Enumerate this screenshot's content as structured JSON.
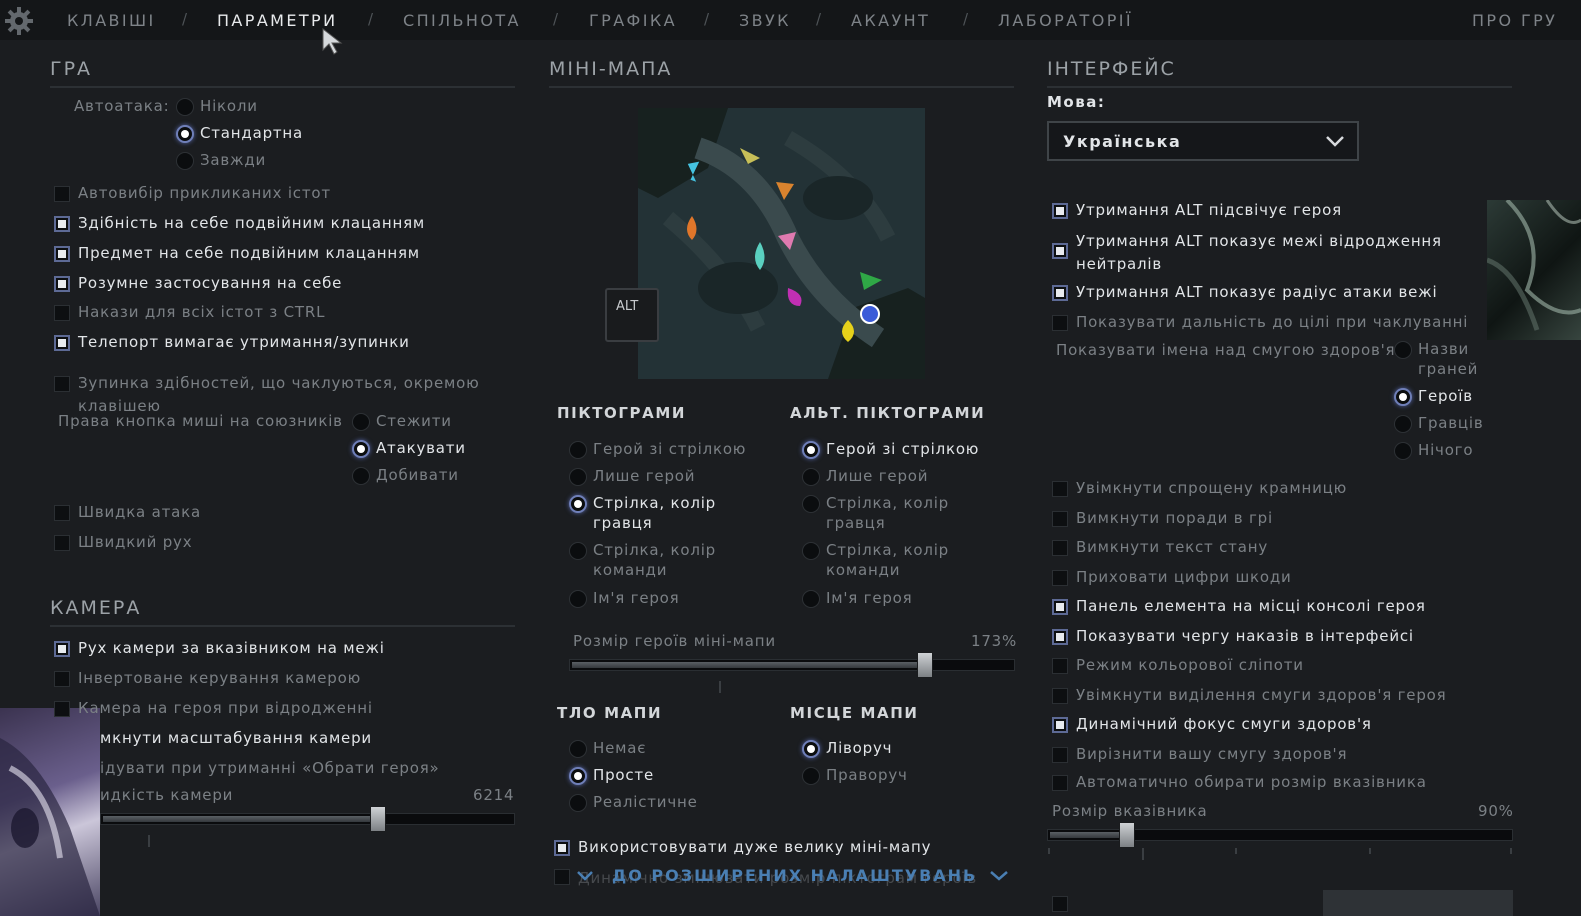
{
  "nav": {
    "items": [
      "КЛАВІШІ",
      "ПАРАМЕТРИ",
      "СПІЛЬНОТА",
      "ГРАФІКА",
      "ЗВУК",
      "АКАУНТ",
      "ЛАБОРАТОРІЇ"
    ],
    "sep": "/",
    "about": "ПРО ГРУ",
    "active": "ПАРАМЕТРИ"
  },
  "game": {
    "title": "ГРА",
    "autoattack_label": "Автоатака:",
    "autoattack_options": [
      "Ніколи",
      "Стандартна",
      "Завжди"
    ],
    "autoattack_selected": "Стандартна",
    "checks": [
      {
        "label": "Автовибір прикликаних істот",
        "checked": false
      },
      {
        "label": "Здібність на себе подвійним клацанням",
        "checked": true
      },
      {
        "label": "Предмет на себе подвійним клацанням",
        "checked": true
      },
      {
        "label": "Розумне застосування на себе",
        "checked": true
      },
      {
        "label": "Накази для всіх істот з CTRL",
        "checked": false
      },
      {
        "label": "Телепорт вимагає утримання/зупинки",
        "checked": true
      },
      {
        "label1": "Зупинка здібностей, що чаклуються, окремою",
        "label2": "клавішею",
        "checked": false
      }
    ],
    "rmb_label": "Права кнопка миші на союзників",
    "rmb_options": [
      "Стежити",
      "Атакувати",
      "Добивати"
    ],
    "rmb_selected": "Атакувати",
    "quick": [
      {
        "label": "Швидка атака",
        "checked": false
      },
      {
        "label": "Швидкий рух",
        "checked": false
      }
    ]
  },
  "camera": {
    "title": "КАМЕРА",
    "checks": [
      {
        "label": "Рух камери за вказівником на межі",
        "checked": true
      },
      {
        "label": "Інвертоване керування камерою",
        "checked": false
      },
      {
        "label": "Камера на героя при відродженні",
        "checked": false
      }
    ],
    "extra1": "мкнути масштабування камери",
    "extra2": "ідувати при утриманні «Обрати героя»",
    "speed_label": "идкість камери",
    "speed_value": "6214",
    "speed_fraction": 0.67
  },
  "minimap": {
    "title": "МІНІ-МАПА",
    "alt_key": "ALT",
    "icons_title": "ПІКТОГРАМИ",
    "alt_icons_title": "АЛЬТ. ПІКТОГРАМИ",
    "icon_options": [
      {
        "l1": "Герой зі стрілкою",
        "l2": ""
      },
      {
        "l1": "Лише герой",
        "l2": ""
      },
      {
        "l1": "Стрілка, колір",
        "l2": "гравця"
      },
      {
        "l1": "Стрілка, колір",
        "l2": "команди"
      },
      {
        "l1": "Ім'я героя",
        "l2": ""
      }
    ],
    "icons_selected": 2,
    "alt_icons_selected": 0,
    "hero_size_label": "Розмір героїв міні-мапи",
    "hero_size_value": "173%",
    "hero_size_fraction": 0.8,
    "bg_title": "ТЛО МАПИ",
    "bg_options": [
      "Немає",
      "Просте",
      "Реалістичне"
    ],
    "bg_selected": "Просте",
    "place_title": "МІСЦЕ МАПИ",
    "place_options": [
      "Ліворуч",
      "Праворуч"
    ],
    "place_selected": "Ліворуч",
    "large_map": {
      "label": "Використовувати дуже велику міні-мапу",
      "checked": true
    },
    "dynamic_label": "Динамічно змінювати розмір піктограм героїв",
    "advanced_link": "ДО РОЗШИРЕНИХ НАЛАШТУВАНЬ"
  },
  "interface": {
    "title": "ІНТЕРФЕЙС",
    "lang_label": "Мова:",
    "lang_value": "Українська",
    "checks_top": [
      {
        "l1": "Утримання ALT підсвічує героя",
        "l2": "",
        "checked": true
      },
      {
        "l1": "Утримання ALT показує межі відродження",
        "l2": "нейтралів",
        "checked": true
      },
      {
        "l1": "Утримання ALT показує радіус атаки вежі",
        "l2": "",
        "checked": true
      },
      {
        "l1": "Показувати дальність до цілі при чаклуванні",
        "l2": "",
        "checked": false
      }
    ],
    "names_label": "Показувати імена над смугою здоров'я",
    "names_options": [
      {
        "l1": "Назви",
        "l2": "граней"
      },
      {
        "l1": "Героїв",
        "l2": ""
      },
      {
        "l1": "Гравців",
        "l2": ""
      },
      {
        "l1": "Нічого",
        "l2": ""
      }
    ],
    "names_selected": 1,
    "checks_bottom": [
      {
        "label": "Увімкнути спрощену крамницю",
        "checked": false
      },
      {
        "label": "Вимкнути поради в грі",
        "checked": false
      },
      {
        "label": "Вимкнути текст стану",
        "checked": false
      },
      {
        "label": "Приховати цифри шкоди",
        "checked": false
      },
      {
        "label": "Панель елемента на місці консолі героя",
        "checked": true
      },
      {
        "label": "Показувати чергу наказів в інтерфейсі",
        "checked": true
      },
      {
        "label": "Режим кольорової сліпоти",
        "checked": false
      },
      {
        "label": "Увімкнути виділення смуги здоров'я героя",
        "checked": false
      },
      {
        "label": "Динамічний фокус смуги здоров'я",
        "checked": true
      },
      {
        "label": "Вирізнити вашу смугу здоров'я",
        "checked": false
      },
      {
        "label": "Автоматично обирати розмір вказівника",
        "checked": false
      }
    ],
    "pointer_label": "Розмір вказівника",
    "pointer_value": "90%",
    "pointer_fraction": 0.17
  }
}
